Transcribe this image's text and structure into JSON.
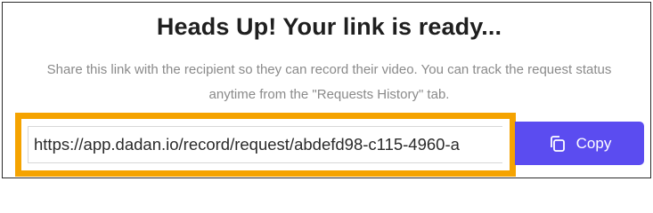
{
  "dialog": {
    "title": "Heads Up! Your link is ready...",
    "description": "Share this link with the recipient so they can record their video. You can track the request status anytime from the \"Requests History\" tab."
  },
  "link": {
    "value": "https://app.dadan.io/record/request/abdefd98-c115-4960-a"
  },
  "copy_button": {
    "label": "Copy",
    "icon": "copy-icon"
  },
  "colors": {
    "highlight": "#f5a300",
    "button": "#5b4cf0"
  }
}
